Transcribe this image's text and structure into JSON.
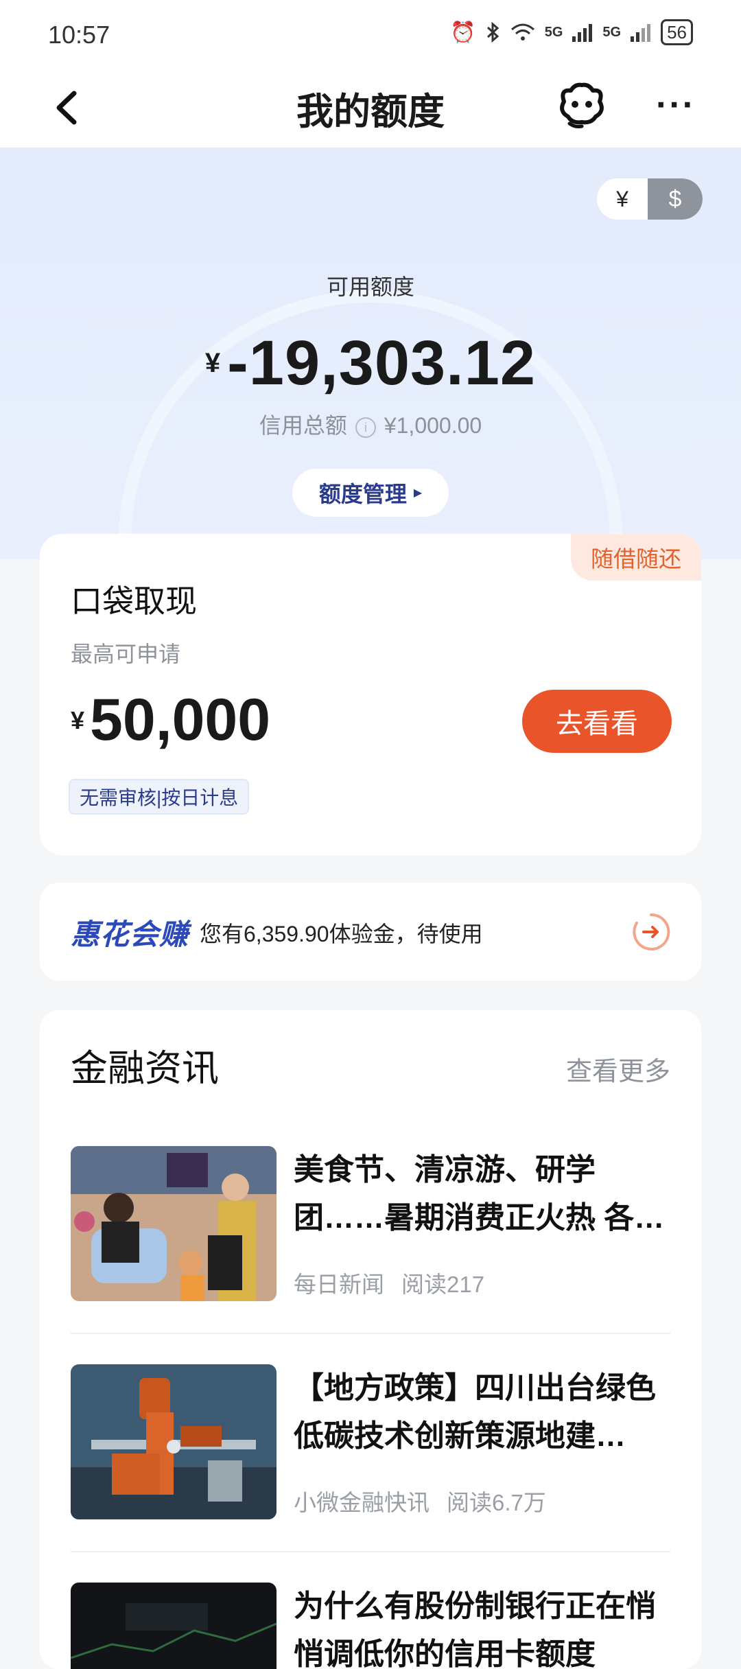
{
  "status_bar": {
    "time": "10:57",
    "signal1": "5G",
    "signal2": "5G",
    "battery": "56"
  },
  "nav": {
    "title": "我的额度"
  },
  "hero": {
    "currency_toggle": {
      "left": "¥",
      "right": "$"
    },
    "available_label": "可用额度",
    "currency_symbol": "¥",
    "available_amount": "-19,303.12",
    "credit_total_label": "信用总额",
    "credit_total_value": "¥1,000.00",
    "manage_label": "额度管理"
  },
  "cash_card": {
    "badge": "随借随还",
    "title": "口袋取现",
    "subtitle": "最高可申请",
    "currency_symbol": "¥",
    "amount": "50,000",
    "button": "去看看",
    "tag": "无需审核|按日计息"
  },
  "promo": {
    "logo": "惠花会赚",
    "text": "您有6,359.90体验金，待使用"
  },
  "news": {
    "title": "金融资讯",
    "more": "查看更多",
    "items": [
      {
        "headline": "美食节、清凉游、研学团……暑期消费正火热 各…",
        "source": "每日新闻",
        "reads": "阅读217"
      },
      {
        "headline": "【地方政策】四川出台绿色低碳技术创新策源地建…",
        "source": "小微金融快讯",
        "reads": "阅读6.7万"
      },
      {
        "headline": "为什么有股份制银行正在悄悄调低你的信用卡额度",
        "source": "",
        "reads": ""
      }
    ]
  },
  "colors": {
    "accent_orange": "#e9542a",
    "brand_blue": "#2b49b8",
    "hero_bg": "#e3ebfb"
  },
  "icons": [
    "back-icon",
    "bluetooth-icon",
    "wifi-icon",
    "alarm-icon",
    "robot-service-icon",
    "more-icon",
    "info-icon",
    "arrow-circle-icon"
  ]
}
